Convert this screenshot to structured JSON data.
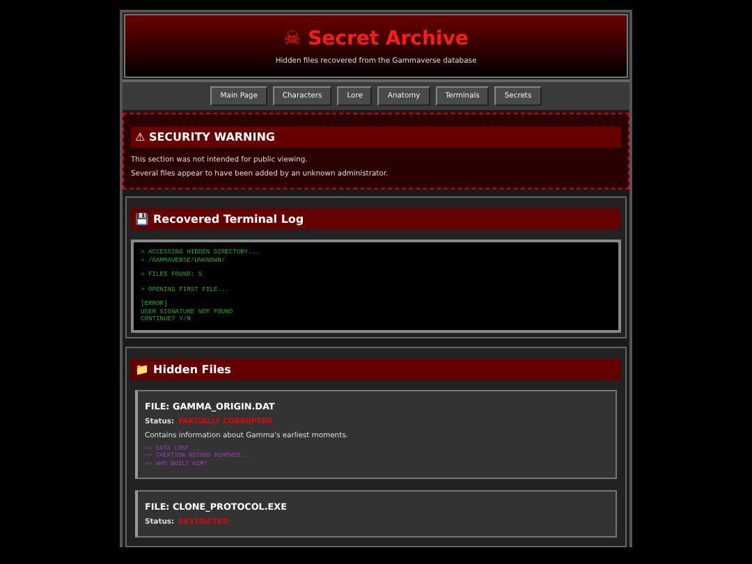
{
  "header": {
    "icon": "☠",
    "title": "Secret Archive",
    "subtitle": "Hidden files recovered from the Gammaverse database"
  },
  "nav": [
    "Main Page",
    "Characters",
    "Lore",
    "Anatomy",
    "Terminals",
    "Secrets"
  ],
  "warning": {
    "title": "⚠ SECURITY WARNING",
    "lines": [
      "This section was not intended for public viewing.",
      "Several files appear to have been added by an unknown administrator."
    ]
  },
  "terminal_section": {
    "icon": "💾",
    "title": "Recovered Terminal Log",
    "line_groups": [
      [
        "> ACCESSING HIDDEN DIRECTORY...",
        "> /GAMMAVERSE/UNKNOWN/"
      ],
      [
        "> FILES FOUND: 5"
      ],
      [
        "> OPENING FIRST FILE..."
      ],
      [
        "[ERROR]",
        "USER SIGNATURE NOT FOUND",
        "CONTINUE? Y/N"
      ]
    ]
  },
  "files_section": {
    "icon": "📁",
    "title": "Hidden Files",
    "files": [
      {
        "name": "FILE: GAMMA_ORIGIN.DAT",
        "status_label": "Status:",
        "status": "PARTIALLY CORRUPTED",
        "description": "Contains information about Gamma's earliest moments.",
        "log": [
          ">> DATA LOST...",
          ">> CREATION RECORD REMOVED...",
          ">> WHO BUILT HIM?"
        ]
      },
      {
        "name": "FILE: CLONE_PROTOCOL.EXE",
        "status_label": "Status:",
        "status": "RESTRICTED"
      }
    ]
  }
}
